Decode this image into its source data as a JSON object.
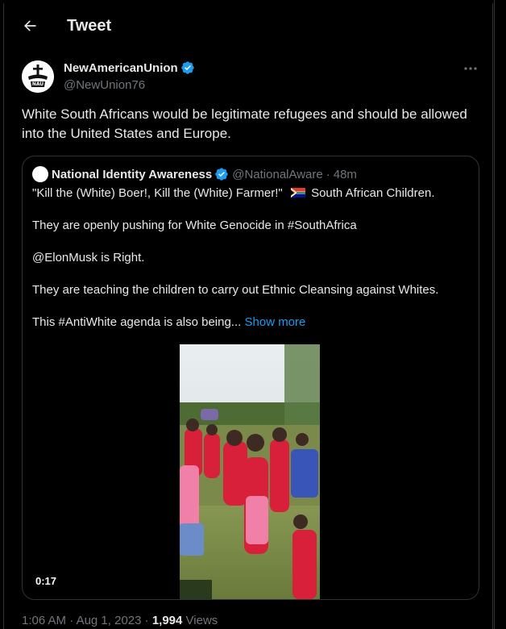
{
  "header": {
    "title": "Tweet"
  },
  "tweet": {
    "display_name": "NewAmericanUnion",
    "handle": "@NewUnion76",
    "avatar_text": "NAU",
    "text": "White South Africans would be legitimate refugees and should be allowed into the United States and Europe.",
    "time": "1:06 AM",
    "date": "Aug 1, 2023",
    "views_count": "1,994",
    "views_label": "Views",
    "sep": "·"
  },
  "quote": {
    "display_name": "National Identity Awareness",
    "handle": "@NationalAware",
    "sep": "·",
    "time": "48m",
    "lines": [
      "\"Kill the (White) Boer!, Kill the (White) Farmer!\"",
      "South African Children.",
      "They are openly pushing for White Genocide in #SouthAfrica",
      "@ElonMusk is Right.",
      "They are teaching the children to carry out Ethnic Cleansing against Whites.",
      "This #AntiWhite agenda is also being..."
    ],
    "show_more": "Show more",
    "video_duration": "0:17"
  },
  "colors": {
    "background": "#000000",
    "accent": "#1d9bf0",
    "muted": "#71767b",
    "text": "#e7e9ea",
    "border": "#2f3336"
  },
  "icons": {
    "back": "arrow-left-icon",
    "verified": "verified-badge-icon",
    "more": "more-horizontal-icon",
    "flag": "south-africa-flag-icon"
  }
}
